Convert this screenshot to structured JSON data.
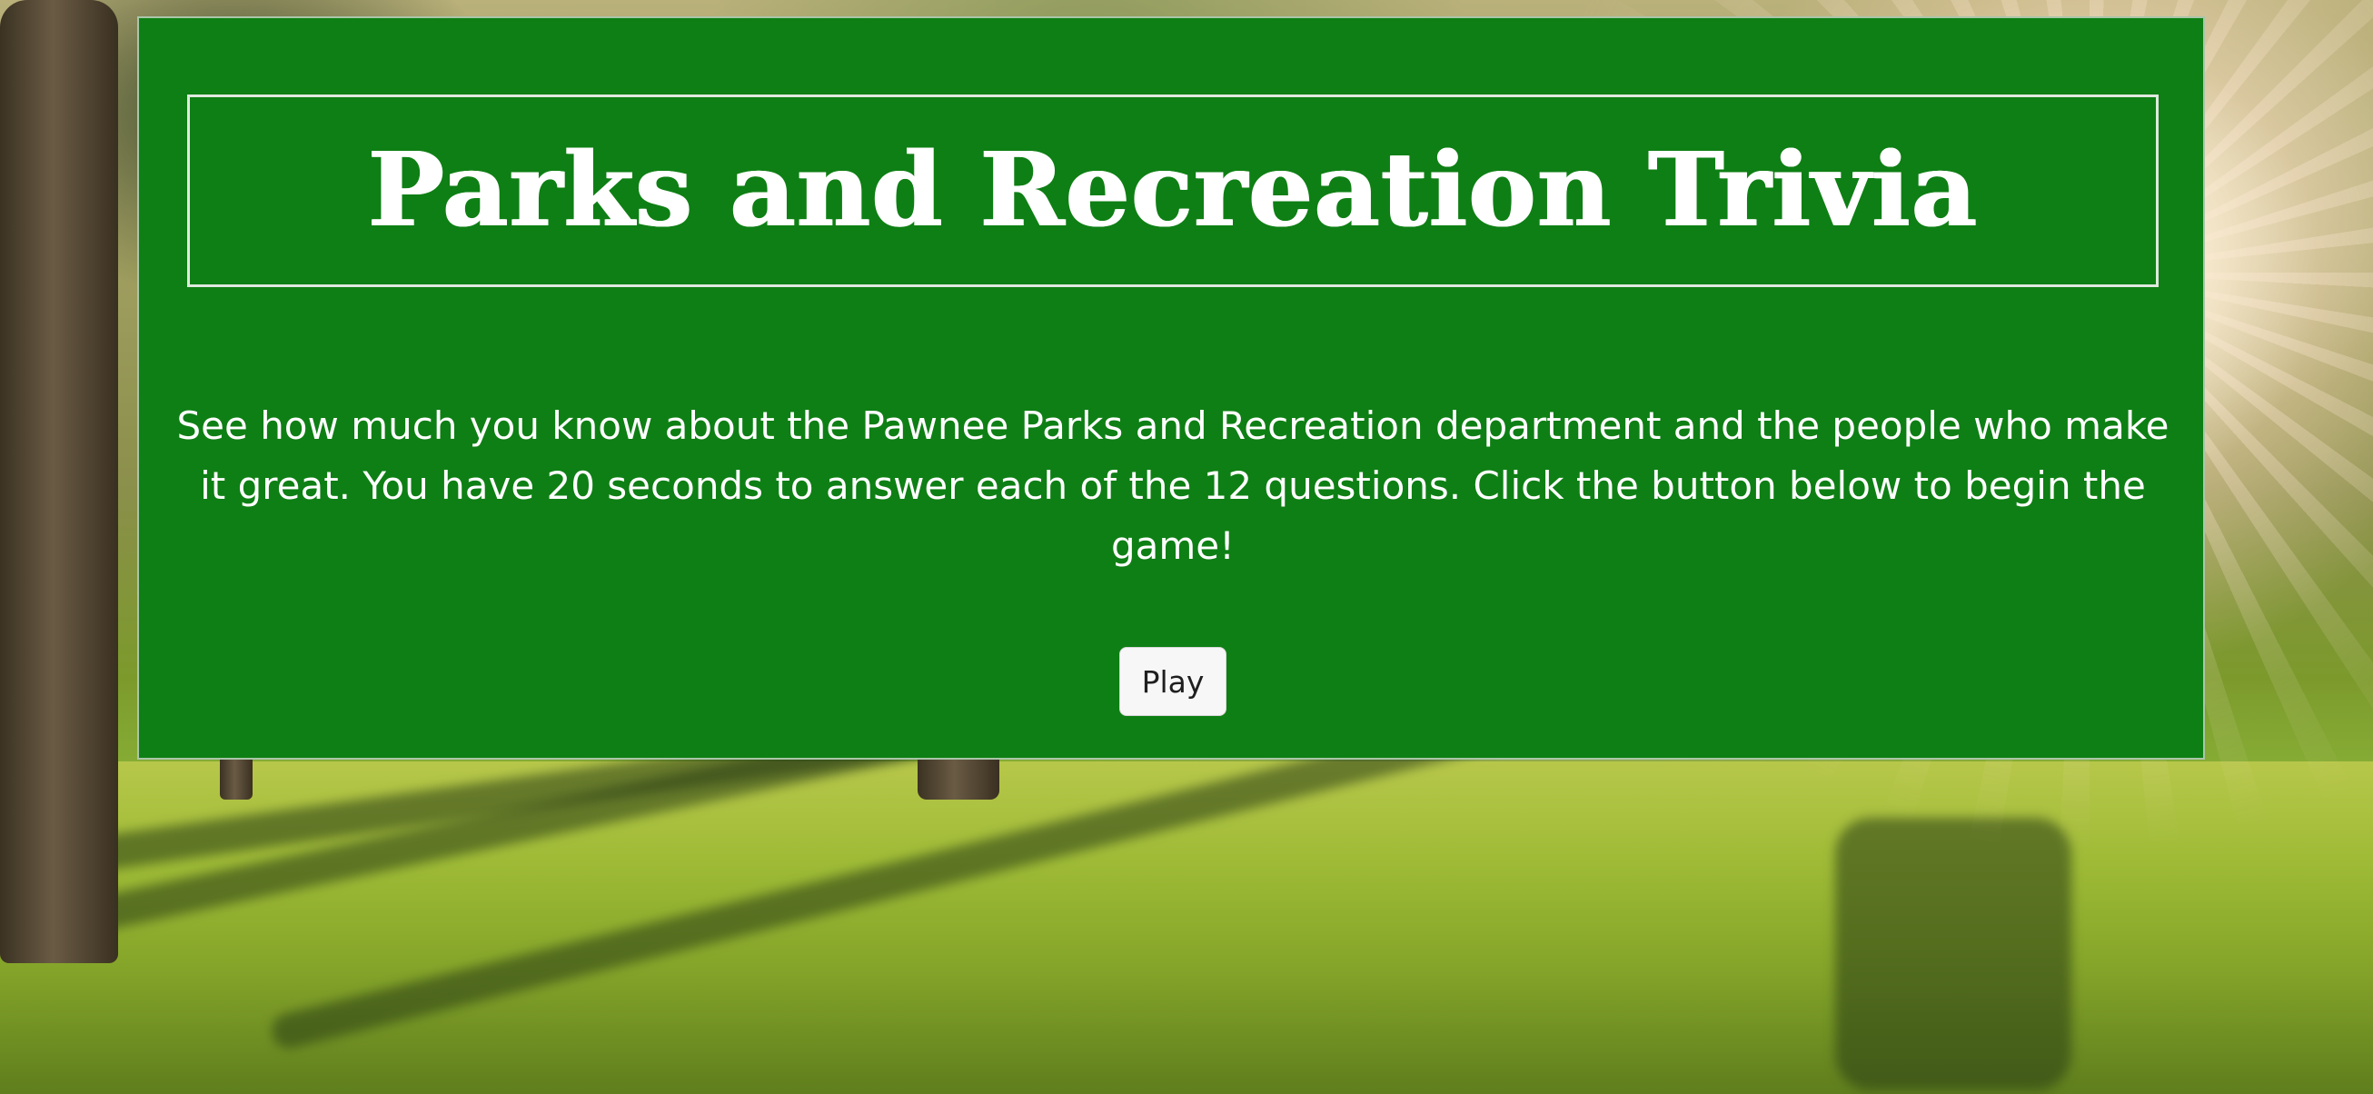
{
  "page": {
    "title": "Parks and Recreation Trivia",
    "description": "See how much you know about the Pawnee Parks and Recreation department and the people who make it great. You have 20 seconds to answer each of the 12 questions. Click the button below to begin the game!"
  },
  "controls": {
    "play_label": "Play"
  },
  "colors": {
    "card_background": "#0e7f14",
    "text": "#ffffff",
    "button_background": "#f7f7f7"
  }
}
